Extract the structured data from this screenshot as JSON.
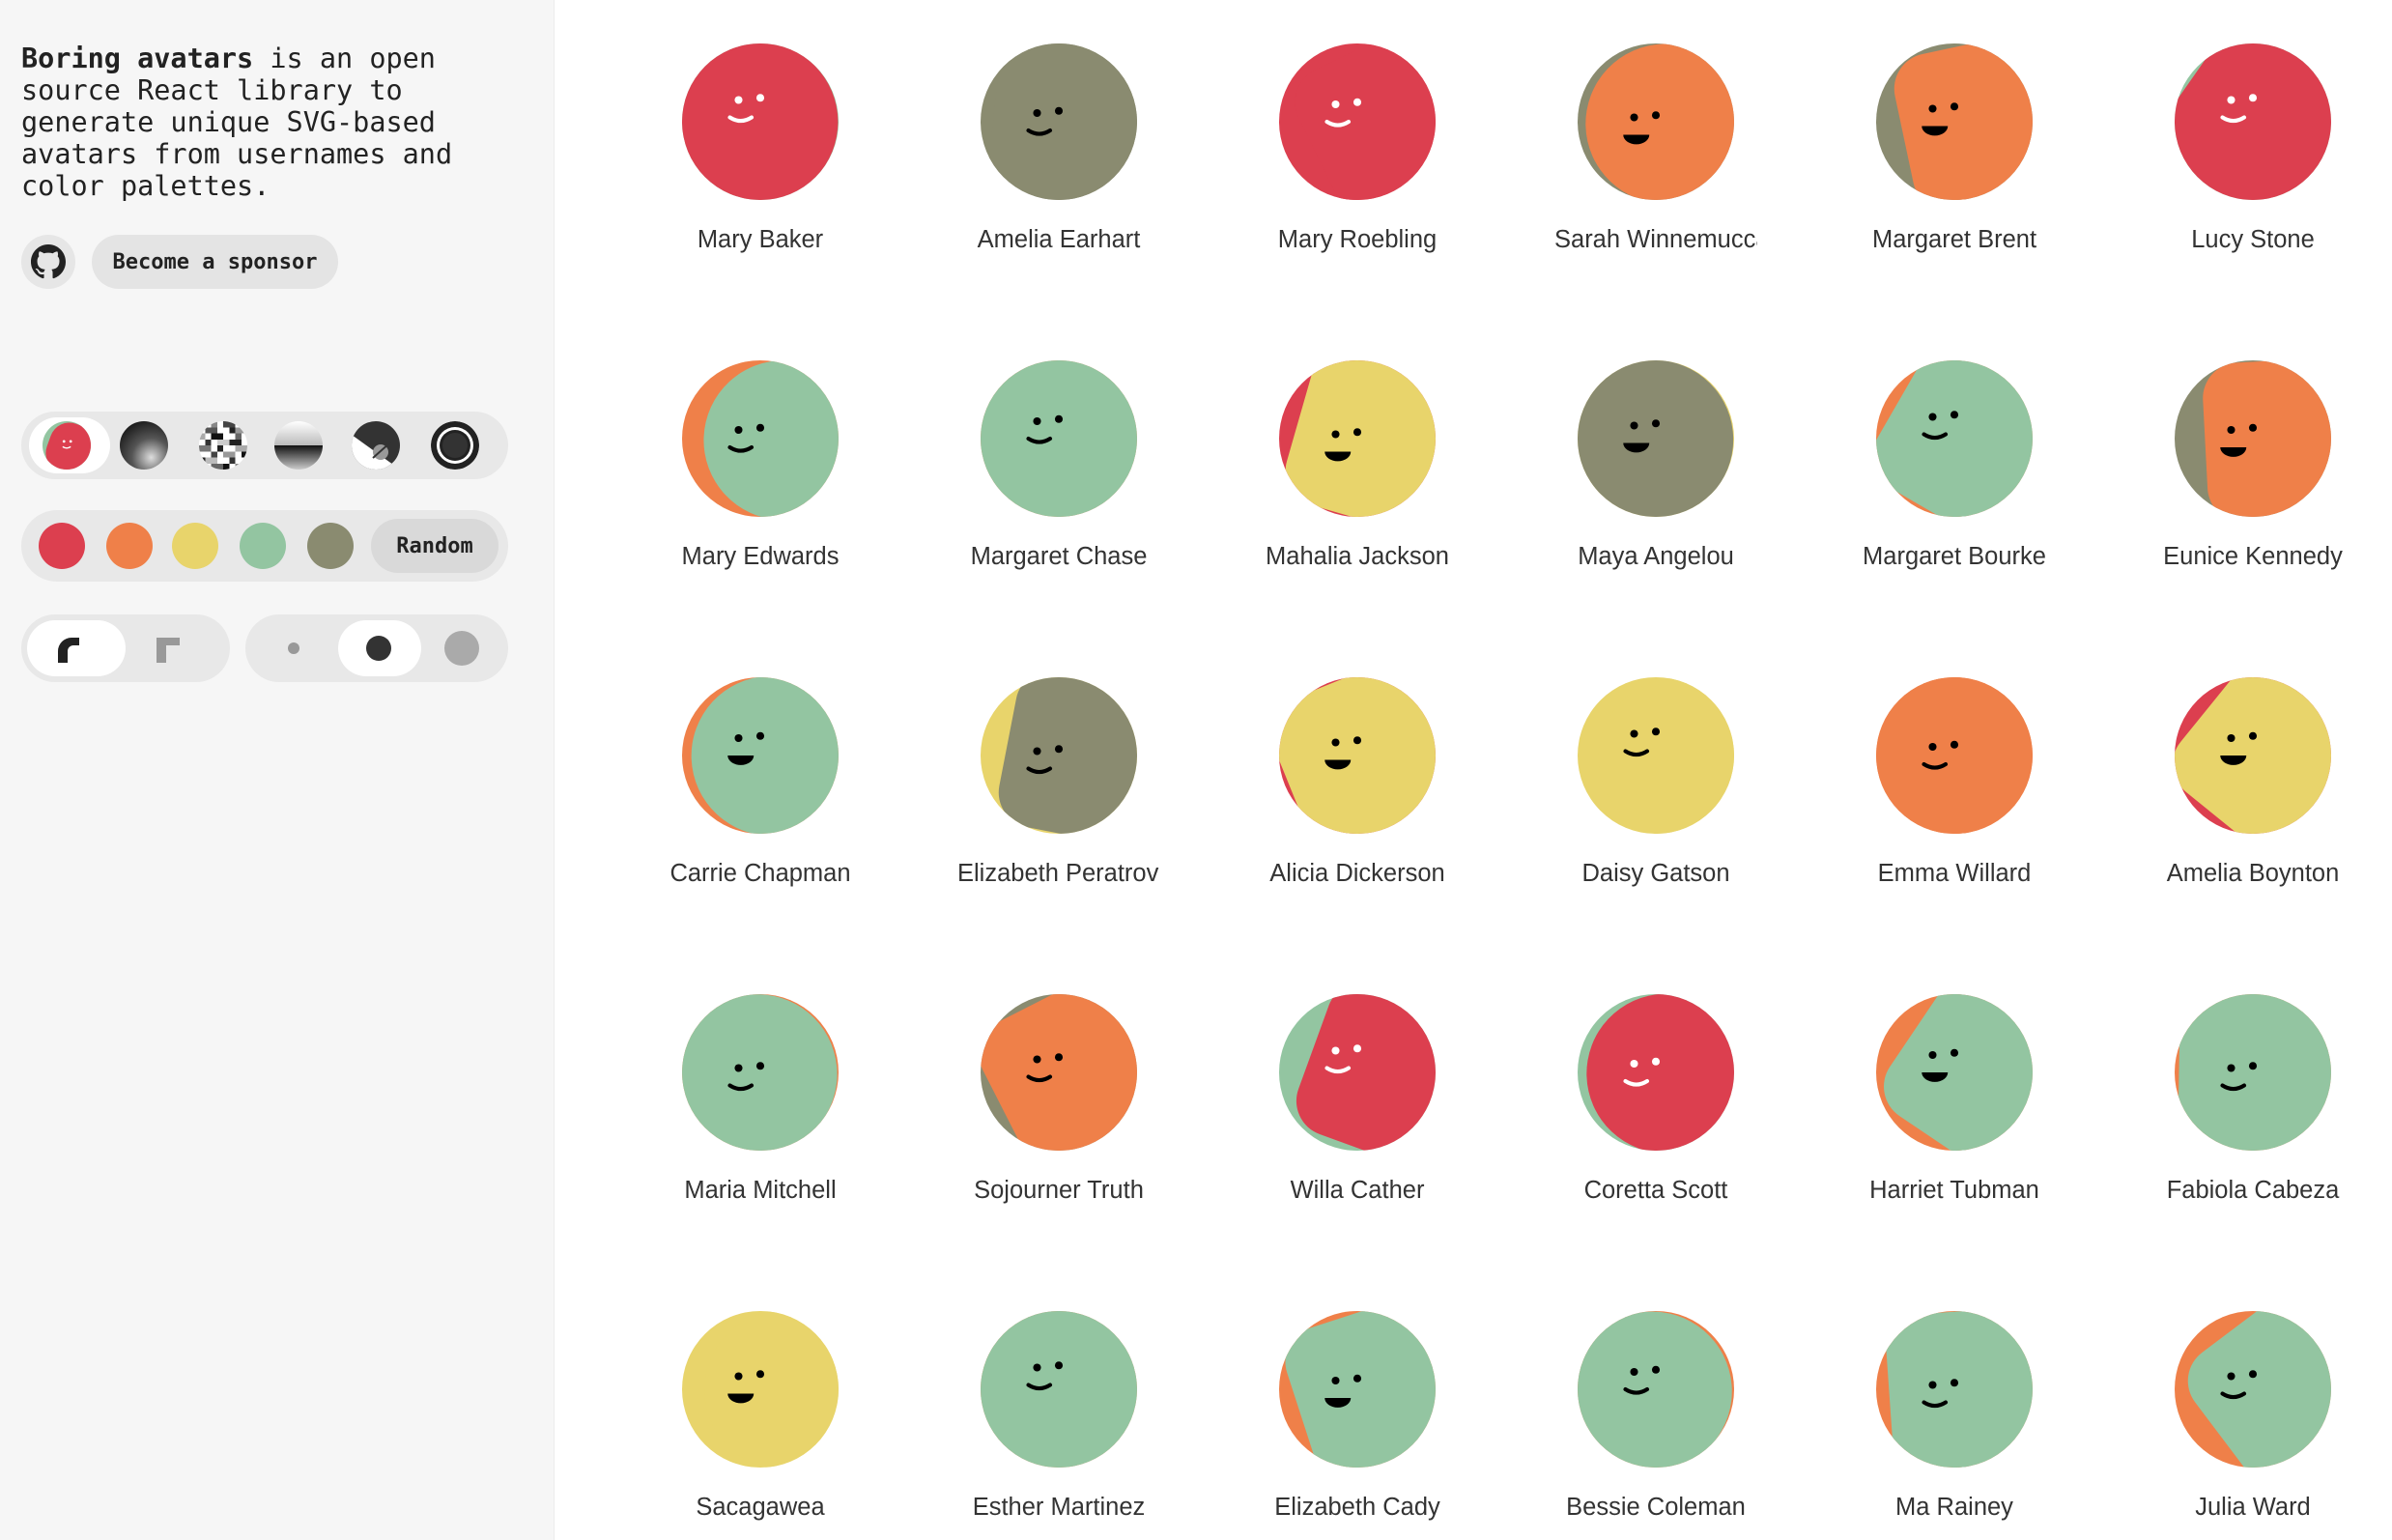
{
  "sidebar": {
    "intro_brand": "Boring avatars",
    "intro_rest": " is an open source React library to generate unique SVG-based avatars from usernames and color palettes.",
    "github_icon": "github-icon",
    "sponsor_label": "Become a sponsor",
    "variants": [
      "beam",
      "marble",
      "pixel",
      "sunset",
      "bauhaus",
      "ring"
    ],
    "selected_variant": "beam",
    "palette": [
      "#dc3f4f",
      "#ef8049",
      "#e8d46b",
      "#93c5a1",
      "#8a8b70"
    ],
    "random_label": "Random",
    "shape_options": [
      "round",
      "square"
    ],
    "selected_shape": "round",
    "size_options": [
      "small",
      "medium",
      "large"
    ],
    "selected_size": "medium"
  },
  "avatars": [
    {
      "name": "Mary Baker",
      "bg": "#93c5a1",
      "fg": "#dc3f4f",
      "face": "#ffffff",
      "mouth": "smile"
    },
    {
      "name": "Amelia Earhart",
      "bg": "#8a8b70",
      "fg": "#8a8b70",
      "face": "#000000",
      "mouth": "smile"
    },
    {
      "name": "Mary Roebling",
      "bg": "#dc3f4f",
      "fg": "#dc3f4f",
      "face": "#ffffff",
      "mouth": "smile"
    },
    {
      "name": "Sarah Winnemucca",
      "bg": "#8a8b70",
      "fg": "#ef8049",
      "face": "#000000",
      "mouth": "open"
    },
    {
      "name": "Margaret Brent",
      "bg": "#8a8b70",
      "fg": "#ef8049",
      "face": "#000000",
      "mouth": "open"
    },
    {
      "name": "Lucy Stone",
      "bg": "#93c5a1",
      "fg": "#dc3f4f",
      "face": "#ffffff",
      "mouth": "smile"
    },
    {
      "name": "Mary Edwards",
      "bg": "#ef8049",
      "fg": "#93c5a1",
      "face": "#000000",
      "mouth": "smile"
    },
    {
      "name": "Margaret Chase",
      "bg": "#ef8049",
      "fg": "#93c5a1",
      "face": "#000000",
      "mouth": "smile"
    },
    {
      "name": "Mahalia Jackson",
      "bg": "#dc3f4f",
      "fg": "#e8d46b",
      "face": "#000000",
      "mouth": "open"
    },
    {
      "name": "Maya Angelou",
      "bg": "#e8d46b",
      "fg": "#8a8b70",
      "face": "#000000",
      "mouth": "open"
    },
    {
      "name": "Margaret Bourke",
      "bg": "#ef8049",
      "fg": "#93c5a1",
      "face": "#000000",
      "mouth": "smile"
    },
    {
      "name": "Eunice Kennedy",
      "bg": "#8a8b70",
      "fg": "#ef8049",
      "face": "#000000",
      "mouth": "open"
    },
    {
      "name": "Carrie Chapman",
      "bg": "#ef8049",
      "fg": "#93c5a1",
      "face": "#000000",
      "mouth": "open"
    },
    {
      "name": "Elizabeth Peratrovich",
      "bg": "#e8d46b",
      "fg": "#8a8b70",
      "face": "#000000",
      "mouth": "smile"
    },
    {
      "name": "Alicia Dickerson",
      "bg": "#dc3f4f",
      "fg": "#e8d46b",
      "face": "#000000",
      "mouth": "open"
    },
    {
      "name": "Daisy Gatson",
      "bg": "#e8d46b",
      "fg": "#e8d46b",
      "face": "#000000",
      "mouth": "smile"
    },
    {
      "name": "Emma Willard",
      "bg": "#ef8049",
      "fg": "#ef8049",
      "face": "#000000",
      "mouth": "smile"
    },
    {
      "name": "Amelia Boynton",
      "bg": "#dc3f4f",
      "fg": "#e8d46b",
      "face": "#000000",
      "mouth": "open"
    },
    {
      "name": "Maria Mitchell",
      "bg": "#ef8049",
      "fg": "#93c5a1",
      "face": "#000000",
      "mouth": "smile"
    },
    {
      "name": "Sojourner Truth",
      "bg": "#8a8b70",
      "fg": "#ef8049",
      "face": "#000000",
      "mouth": "smile"
    },
    {
      "name": "Willa Cather",
      "bg": "#93c5a1",
      "fg": "#dc3f4f",
      "face": "#ffffff",
      "mouth": "smile"
    },
    {
      "name": "Coretta Scott",
      "bg": "#93c5a1",
      "fg": "#dc3f4f",
      "face": "#ffffff",
      "mouth": "smile"
    },
    {
      "name": "Harriet Tubman",
      "bg": "#ef8049",
      "fg": "#93c5a1",
      "face": "#000000",
      "mouth": "open"
    },
    {
      "name": "Fabiola Cabeza",
      "bg": "#ef8049",
      "fg": "#93c5a1",
      "face": "#000000",
      "mouth": "smile"
    },
    {
      "name": "Sacagawea",
      "bg": "#e8d46b",
      "fg": "#e8d46b",
      "face": "#000000",
      "mouth": "open"
    },
    {
      "name": "Esther Martinez",
      "bg": "#ef8049",
      "fg": "#93c5a1",
      "face": "#000000",
      "mouth": "smile"
    },
    {
      "name": "Elizabeth Cady",
      "bg": "#ef8049",
      "fg": "#93c5a1",
      "face": "#000000",
      "mouth": "open"
    },
    {
      "name": "Bessie Coleman",
      "bg": "#ef8049",
      "fg": "#93c5a1",
      "face": "#000000",
      "mouth": "smile"
    },
    {
      "name": "Ma Rainey",
      "bg": "#ef8049",
      "fg": "#93c5a1",
      "face": "#000000",
      "mouth": "smile"
    },
    {
      "name": "Julia Ward",
      "bg": "#ef8049",
      "fg": "#93c5a1",
      "face": "#000000",
      "mouth": "smile"
    }
  ]
}
